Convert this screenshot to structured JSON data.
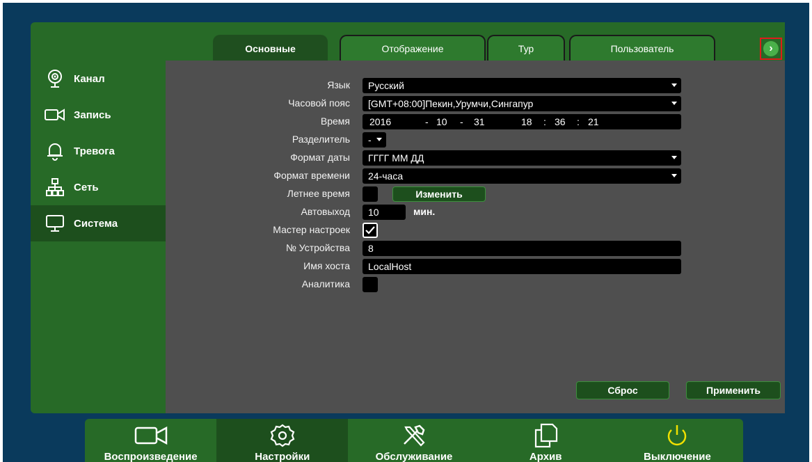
{
  "sidebar": {
    "items": [
      {
        "label": "Канал",
        "icon": "camera-icon"
      },
      {
        "label": "Запись",
        "icon": "record-icon"
      },
      {
        "label": "Тревога",
        "icon": "bell-icon"
      },
      {
        "label": "Сеть",
        "icon": "network-icon"
      },
      {
        "label": "Система",
        "icon": "monitor-icon",
        "active": true
      }
    ]
  },
  "tabs": [
    {
      "label": "Основные",
      "active": true
    },
    {
      "label": "Отображение"
    },
    {
      "label": "Тур"
    },
    {
      "label": "Пользователь"
    }
  ],
  "next_tab_icon": "chevron-right-icon",
  "form": {
    "language": {
      "label": "Язык",
      "value": "Русский"
    },
    "timezone": {
      "label": "Часовой пояс",
      "value": "[GMT+08:00]Пекин,Урумчи,Сингапур"
    },
    "time": {
      "label": "Время",
      "year": "2016",
      "sep1": "-",
      "month": "10",
      "sep2": "-",
      "day": "31",
      "hour": "18",
      "sep3": ":",
      "minute": "36",
      "sep4": ":",
      "second": "21"
    },
    "separator": {
      "label": "Разделитель",
      "value": "-"
    },
    "date_format": {
      "label": "Формат даты",
      "value": "ГГГГ ММ ДД"
    },
    "time_format": {
      "label": "Формат времени",
      "value": "24-часа"
    },
    "dst": {
      "label": "Летнее время",
      "checked": false,
      "button": "Изменить"
    },
    "autologout": {
      "label": "Автовыход",
      "value": "10",
      "unit": "мин."
    },
    "wizard": {
      "label": "Мастер настроек",
      "checked": true
    },
    "device_no": {
      "label": "№ Устройства",
      "value": "8"
    },
    "hostname": {
      "label": "Имя хоста",
      "value": "LocalHost"
    },
    "analytics": {
      "label": "Аналитика",
      "checked": false
    }
  },
  "actions": {
    "reset": "Сброс",
    "apply": "Применить"
  },
  "bottombar": [
    {
      "label": "Воспроизведение",
      "icon": "video-camera-icon"
    },
    {
      "label": "Настройки",
      "icon": "gear-icon",
      "active": true
    },
    {
      "label": "Обслуживание",
      "icon": "tools-icon"
    },
    {
      "label": "Архив",
      "icon": "files-icon"
    },
    {
      "label": "Выключение",
      "icon": "power-icon"
    }
  ],
  "colors": {
    "accent_green": "#276a27",
    "dark_green": "#1d4f1d",
    "panel": "#4f4f4f",
    "highlight_red": "#e01b1b",
    "power_yellow": "#f0e000"
  }
}
